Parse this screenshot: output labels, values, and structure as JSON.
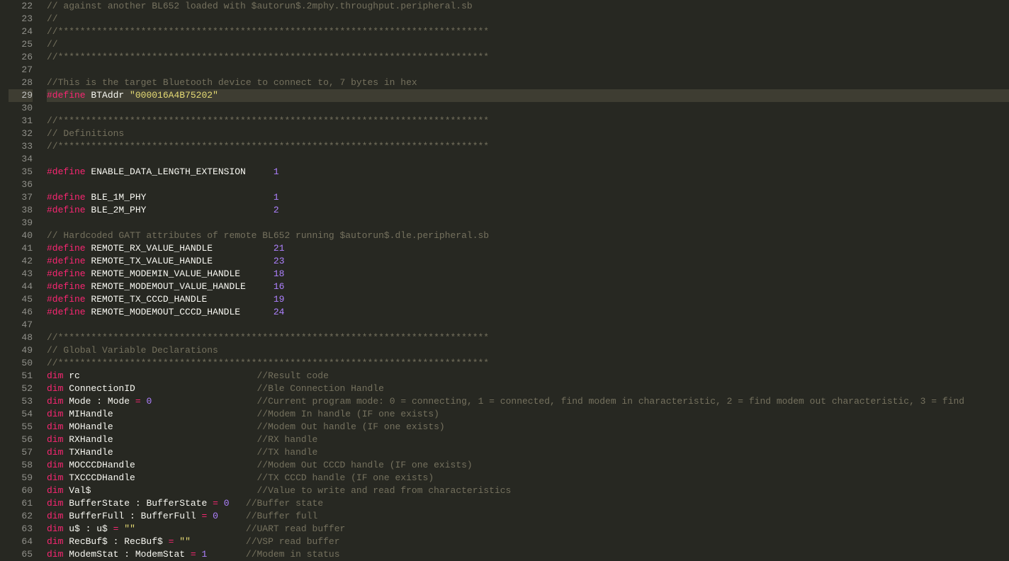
{
  "startLine": 22,
  "activeLine": 29,
  "lines": [
    {
      "tokens": [
        {
          "t": "comment",
          "s": "// against another BL652 loaded with $autorun$.2mphy.throughput.peripheral.sb"
        }
      ]
    },
    {
      "tokens": [
        {
          "t": "comment",
          "s": "//"
        }
      ]
    },
    {
      "tokens": [
        {
          "t": "comment",
          "s": "//******************************************************************************"
        }
      ]
    },
    {
      "tokens": [
        {
          "t": "comment",
          "s": "//"
        }
      ]
    },
    {
      "tokens": [
        {
          "t": "comment",
          "s": "//******************************************************************************"
        }
      ]
    },
    {
      "tokens": []
    },
    {
      "tokens": [
        {
          "t": "comment",
          "s": "//This is the target Bluetooth device to connect to, 7 bytes in hex"
        }
      ]
    },
    {
      "tokens": [
        {
          "t": "keyword",
          "s": "#define"
        },
        {
          "t": "plain",
          "s": " "
        },
        {
          "t": "name",
          "s": "BTAddr"
        },
        {
          "t": "plain",
          "s": " "
        },
        {
          "t": "str",
          "s": "\"000016A4B75202\""
        }
      ]
    },
    {
      "tokens": []
    },
    {
      "tokens": [
        {
          "t": "comment",
          "s": "//******************************************************************************"
        }
      ]
    },
    {
      "tokens": [
        {
          "t": "comment",
          "s": "// Definitions"
        }
      ]
    },
    {
      "tokens": [
        {
          "t": "comment",
          "s": "//******************************************************************************"
        }
      ]
    },
    {
      "tokens": []
    },
    {
      "tokens": [
        {
          "t": "keyword",
          "s": "#define"
        },
        {
          "t": "plain",
          "s": " "
        },
        {
          "t": "name",
          "s": "ENABLE_DATA_LENGTH_EXTENSION"
        },
        {
          "t": "plain",
          "s": "     "
        },
        {
          "t": "num",
          "s": "1"
        }
      ]
    },
    {
      "tokens": []
    },
    {
      "tokens": [
        {
          "t": "keyword",
          "s": "#define"
        },
        {
          "t": "plain",
          "s": " "
        },
        {
          "t": "name",
          "s": "BLE_1M_PHY"
        },
        {
          "t": "plain",
          "s": "                       "
        },
        {
          "t": "num",
          "s": "1"
        }
      ]
    },
    {
      "tokens": [
        {
          "t": "keyword",
          "s": "#define"
        },
        {
          "t": "plain",
          "s": " "
        },
        {
          "t": "name",
          "s": "BLE_2M_PHY"
        },
        {
          "t": "plain",
          "s": "                       "
        },
        {
          "t": "num",
          "s": "2"
        }
      ]
    },
    {
      "tokens": []
    },
    {
      "tokens": [
        {
          "t": "comment",
          "s": "// Hardcoded GATT attributes of remote BL652 running $autorun$.dle.peripheral.sb"
        }
      ]
    },
    {
      "tokens": [
        {
          "t": "keyword",
          "s": "#define"
        },
        {
          "t": "plain",
          "s": " "
        },
        {
          "t": "name",
          "s": "REMOTE_RX_VALUE_HANDLE"
        },
        {
          "t": "plain",
          "s": "           "
        },
        {
          "t": "num",
          "s": "21"
        }
      ]
    },
    {
      "tokens": [
        {
          "t": "keyword",
          "s": "#define"
        },
        {
          "t": "plain",
          "s": " "
        },
        {
          "t": "name",
          "s": "REMOTE_TX_VALUE_HANDLE"
        },
        {
          "t": "plain",
          "s": "           "
        },
        {
          "t": "num",
          "s": "23"
        }
      ]
    },
    {
      "tokens": [
        {
          "t": "keyword",
          "s": "#define"
        },
        {
          "t": "plain",
          "s": " "
        },
        {
          "t": "name",
          "s": "REMOTE_MODEMIN_VALUE_HANDLE"
        },
        {
          "t": "plain",
          "s": "      "
        },
        {
          "t": "num",
          "s": "18"
        }
      ]
    },
    {
      "tokens": [
        {
          "t": "keyword",
          "s": "#define"
        },
        {
          "t": "plain",
          "s": " "
        },
        {
          "t": "name",
          "s": "REMOTE_MODEMOUT_VALUE_HANDLE"
        },
        {
          "t": "plain",
          "s": "     "
        },
        {
          "t": "num",
          "s": "16"
        }
      ]
    },
    {
      "tokens": [
        {
          "t": "keyword",
          "s": "#define"
        },
        {
          "t": "plain",
          "s": " "
        },
        {
          "t": "name",
          "s": "REMOTE_TX_CCCD_HANDLE"
        },
        {
          "t": "plain",
          "s": "            "
        },
        {
          "t": "num",
          "s": "19"
        }
      ]
    },
    {
      "tokens": [
        {
          "t": "keyword",
          "s": "#define"
        },
        {
          "t": "plain",
          "s": " "
        },
        {
          "t": "name",
          "s": "REMOTE_MODEMOUT_CCCD_HANDLE"
        },
        {
          "t": "plain",
          "s": "      "
        },
        {
          "t": "num",
          "s": "24"
        }
      ]
    },
    {
      "tokens": []
    },
    {
      "tokens": [
        {
          "t": "comment",
          "s": "//******************************************************************************"
        }
      ]
    },
    {
      "tokens": [
        {
          "t": "comment",
          "s": "// Global Variable Declarations"
        }
      ]
    },
    {
      "tokens": [
        {
          "t": "comment",
          "s": "//******************************************************************************"
        }
      ]
    },
    {
      "tokens": [
        {
          "t": "dim",
          "s": "dim"
        },
        {
          "t": "plain",
          "s": " "
        },
        {
          "t": "name",
          "s": "rc"
        },
        {
          "t": "plain",
          "s": "                                "
        },
        {
          "t": "comment",
          "s": "//Result code"
        }
      ]
    },
    {
      "tokens": [
        {
          "t": "dim",
          "s": "dim"
        },
        {
          "t": "plain",
          "s": " "
        },
        {
          "t": "name",
          "s": "ConnectionID"
        },
        {
          "t": "plain",
          "s": "                      "
        },
        {
          "t": "comment",
          "s": "//Ble Connection Handle"
        }
      ]
    },
    {
      "tokens": [
        {
          "t": "dim",
          "s": "dim"
        },
        {
          "t": "plain",
          "s": " "
        },
        {
          "t": "name",
          "s": "Mode"
        },
        {
          "t": "plain",
          "s": " : Mode "
        },
        {
          "t": "op",
          "s": "="
        },
        {
          "t": "plain",
          "s": " "
        },
        {
          "t": "num",
          "s": "0"
        },
        {
          "t": "plain",
          "s": "                   "
        },
        {
          "t": "comment",
          "s": "//Current program mode: 0 = connecting, 1 = connected, find modem in characteristic, 2 = find modem out characteristic, 3 = find"
        }
      ]
    },
    {
      "tokens": [
        {
          "t": "dim",
          "s": "dim"
        },
        {
          "t": "plain",
          "s": " "
        },
        {
          "t": "name",
          "s": "MIHandle"
        },
        {
          "t": "plain",
          "s": "                          "
        },
        {
          "t": "comment",
          "s": "//Modem In handle (IF one exists)"
        }
      ]
    },
    {
      "tokens": [
        {
          "t": "dim",
          "s": "dim"
        },
        {
          "t": "plain",
          "s": " "
        },
        {
          "t": "name",
          "s": "MOHandle"
        },
        {
          "t": "plain",
          "s": "                          "
        },
        {
          "t": "comment",
          "s": "//Modem Out handle (IF one exists)"
        }
      ]
    },
    {
      "tokens": [
        {
          "t": "dim",
          "s": "dim"
        },
        {
          "t": "plain",
          "s": " "
        },
        {
          "t": "name",
          "s": "RXHandle"
        },
        {
          "t": "plain",
          "s": "                          "
        },
        {
          "t": "comment",
          "s": "//RX handle"
        }
      ]
    },
    {
      "tokens": [
        {
          "t": "dim",
          "s": "dim"
        },
        {
          "t": "plain",
          "s": " "
        },
        {
          "t": "name",
          "s": "TXHandle"
        },
        {
          "t": "plain",
          "s": "                          "
        },
        {
          "t": "comment",
          "s": "//TX handle"
        }
      ]
    },
    {
      "tokens": [
        {
          "t": "dim",
          "s": "dim"
        },
        {
          "t": "plain",
          "s": " "
        },
        {
          "t": "name",
          "s": "MOCCCDHandle"
        },
        {
          "t": "plain",
          "s": "                      "
        },
        {
          "t": "comment",
          "s": "//Modem Out CCCD handle (IF one exists)"
        }
      ]
    },
    {
      "tokens": [
        {
          "t": "dim",
          "s": "dim"
        },
        {
          "t": "plain",
          "s": " "
        },
        {
          "t": "name",
          "s": "TXCCCDHandle"
        },
        {
          "t": "plain",
          "s": "                      "
        },
        {
          "t": "comment",
          "s": "//TX CCCD handle (IF one exists)"
        }
      ]
    },
    {
      "tokens": [
        {
          "t": "dim",
          "s": "dim"
        },
        {
          "t": "plain",
          "s": " "
        },
        {
          "t": "name",
          "s": "Val$"
        },
        {
          "t": "plain",
          "s": "                              "
        },
        {
          "t": "comment",
          "s": "//Value to write and read from characteristics"
        }
      ]
    },
    {
      "tokens": [
        {
          "t": "dim",
          "s": "dim"
        },
        {
          "t": "plain",
          "s": " "
        },
        {
          "t": "name",
          "s": "BufferState"
        },
        {
          "t": "plain",
          "s": " : BufferState "
        },
        {
          "t": "op",
          "s": "="
        },
        {
          "t": "plain",
          "s": " "
        },
        {
          "t": "num",
          "s": "0"
        },
        {
          "t": "plain",
          "s": "   "
        },
        {
          "t": "comment",
          "s": "//Buffer state"
        }
      ]
    },
    {
      "tokens": [
        {
          "t": "dim",
          "s": "dim"
        },
        {
          "t": "plain",
          "s": " "
        },
        {
          "t": "name",
          "s": "BufferFull"
        },
        {
          "t": "plain",
          "s": " : BufferFull "
        },
        {
          "t": "op",
          "s": "="
        },
        {
          "t": "plain",
          "s": " "
        },
        {
          "t": "num",
          "s": "0"
        },
        {
          "t": "plain",
          "s": "     "
        },
        {
          "t": "comment",
          "s": "//Buffer full"
        }
      ]
    },
    {
      "tokens": [
        {
          "t": "dim",
          "s": "dim"
        },
        {
          "t": "plain",
          "s": " "
        },
        {
          "t": "name",
          "s": "u$"
        },
        {
          "t": "plain",
          "s": " : u$ "
        },
        {
          "t": "op",
          "s": "="
        },
        {
          "t": "plain",
          "s": " "
        },
        {
          "t": "str",
          "s": "\"\""
        },
        {
          "t": "plain",
          "s": "                    "
        },
        {
          "t": "comment",
          "s": "//UART read buffer"
        }
      ]
    },
    {
      "tokens": [
        {
          "t": "dim",
          "s": "dim"
        },
        {
          "t": "plain",
          "s": " "
        },
        {
          "t": "name",
          "s": "RecBuf$"
        },
        {
          "t": "plain",
          "s": " : RecBuf$ "
        },
        {
          "t": "op",
          "s": "="
        },
        {
          "t": "plain",
          "s": " "
        },
        {
          "t": "str",
          "s": "\"\""
        },
        {
          "t": "plain",
          "s": "          "
        },
        {
          "t": "comment",
          "s": "//VSP read buffer"
        }
      ]
    },
    {
      "tokens": [
        {
          "t": "dim",
          "s": "dim"
        },
        {
          "t": "plain",
          "s": " "
        },
        {
          "t": "name",
          "s": "ModemStat"
        },
        {
          "t": "plain",
          "s": " : ModemStat "
        },
        {
          "t": "op",
          "s": "="
        },
        {
          "t": "plain",
          "s": " "
        },
        {
          "t": "num",
          "s": "1"
        },
        {
          "t": "plain",
          "s": "       "
        },
        {
          "t": "comment",
          "s": "//Modem in status"
        }
      ]
    }
  ]
}
